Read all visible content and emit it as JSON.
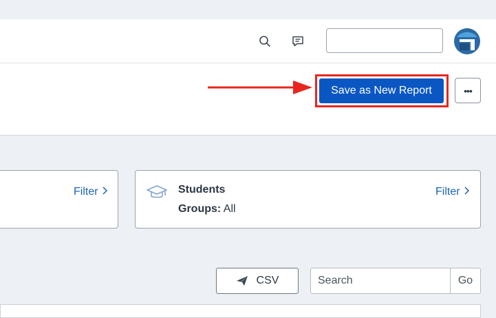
{
  "header": {
    "search_icon": "search-icon",
    "messages_icon": "message-icon",
    "search_field_value": "",
    "avatar_icon": "app-logo-icon"
  },
  "toolbar": {
    "save_label": "Save as New Report",
    "more_label": "•••",
    "accent_color": "#0a57c4",
    "highlight_color": "#e8261f"
  },
  "filters": {
    "left_card": {
      "filter_label": "Filter"
    },
    "students_card": {
      "icon": "graduation-cap-icon",
      "title": "Students",
      "groups_label": "Groups:",
      "groups_value": "All",
      "filter_label": "Filter"
    }
  },
  "actions": {
    "csv_label": "CSV",
    "csv_icon": "send-icon",
    "search_placeholder": "Search",
    "go_label": "Go"
  }
}
